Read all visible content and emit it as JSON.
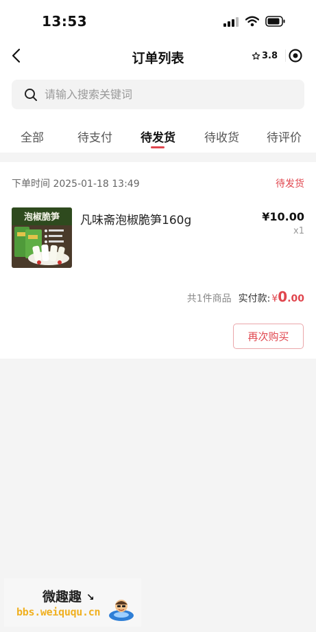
{
  "status_bar": {
    "time": "13:53"
  },
  "nav": {
    "title": "订单列表",
    "rating": "3.8"
  },
  "search": {
    "placeholder": "请输入搜索关键词"
  },
  "tabs": [
    {
      "label": "全部"
    },
    {
      "label": "待支付"
    },
    {
      "label": "待发货",
      "active": true
    },
    {
      "label": "待收货"
    },
    {
      "label": "待评价"
    }
  ],
  "order": {
    "time": "下单时间 2025-01-18 13:49",
    "status": "待发货",
    "product": {
      "image_text": "泡椒脆笋",
      "name": "凡味斋泡椒脆笋160g",
      "price": "¥10.00",
      "qty": "x1"
    },
    "summary": {
      "count": "共1件商品",
      "paid_label": "实付款:",
      "currency": "¥",
      "amount_int": "0",
      "amount_dec": ".00"
    },
    "rebuy_label": "再次购买"
  },
  "watermark": {
    "title": "微趣趣",
    "url": "bbs.weiququ.cn"
  },
  "colors": {
    "accent": "#e0464e",
    "background": "#f4f4f4"
  }
}
